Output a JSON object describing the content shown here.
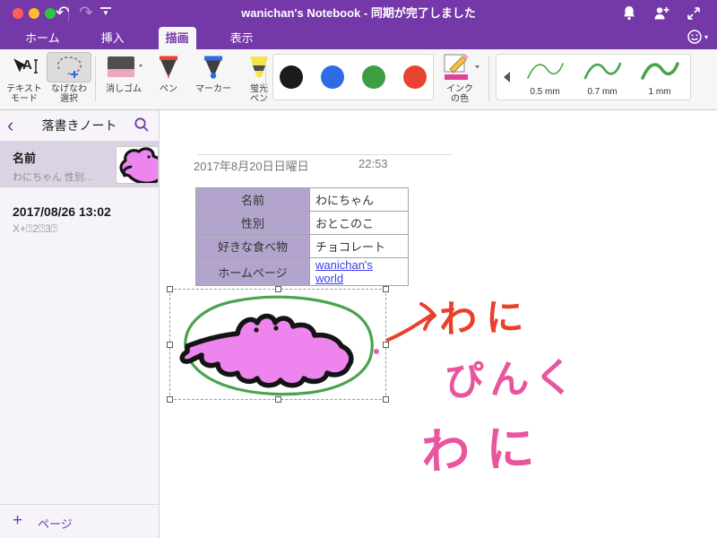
{
  "window": {
    "title": "wanichan's Notebook - 同期が完了しました"
  },
  "tabs": {
    "items": [
      {
        "label": "ホーム",
        "active": false
      },
      {
        "label": "挿入",
        "active": false
      },
      {
        "label": "描画",
        "active": true
      },
      {
        "label": "表示",
        "active": false
      }
    ]
  },
  "ribbon": {
    "text_mode": {
      "line1": "テキスト",
      "line2": "モード"
    },
    "lasso": {
      "line1": "なげなわ",
      "line2": "選択",
      "selected": true
    },
    "eraser": {
      "label": "消しゴム"
    },
    "pen": {
      "label": "ペン"
    },
    "marker": {
      "label": "マーカー"
    },
    "highlighter": {
      "line1": "蛍光",
      "line2": "ペン"
    },
    "ink_color": {
      "line1": "インク",
      "line2": "の色",
      "current": "#e23f97"
    },
    "swatches": [
      {
        "name": "black",
        "hex": "#1b1b1b"
      },
      {
        "name": "blue",
        "hex": "#2e6be4"
      },
      {
        "name": "green",
        "hex": "#3f9e44"
      },
      {
        "name": "red",
        "hex": "#e8432e"
      }
    ],
    "thickness": {
      "stroke_color": "#4ba34b",
      "options": [
        {
          "label": "0.5 mm"
        },
        {
          "label": "0.7 mm"
        },
        {
          "label": "1 mm"
        }
      ]
    }
  },
  "sidebar": {
    "title": "落書きノート",
    "pages": [
      {
        "title": "名前",
        "subtitle": "わにちゃん 性別...",
        "selected": true
      },
      {
        "title": "2017/08/26 13:02",
        "subtitle": "X+⍰2⍰3⍰",
        "selected": false
      }
    ],
    "new_page_label": "ページ"
  },
  "page": {
    "date": "2017年8月20日日曜日",
    "time": "22:53",
    "table": {
      "header_bg": "#b3a4cd",
      "link_color": "#3a3af0",
      "rows": [
        {
          "label": "名前",
          "value": "わにちゃん"
        },
        {
          "label": "性別",
          "value": "おとこのこ"
        },
        {
          "label": "好きな食べ物",
          "value": "チョコレート"
        },
        {
          "label": "ホームページ",
          "value": "wanichan's world"
        }
      ]
    },
    "annotations": {
      "arrow_text": "わに",
      "line2": "ぴんく",
      "line3": "わに",
      "red": "#e8402a",
      "pink": "#e8559c"
    },
    "drawing": {
      "loop_color": "#4ba34b",
      "body_fill": "#ee85ee",
      "body_stroke": "#141414"
    }
  }
}
